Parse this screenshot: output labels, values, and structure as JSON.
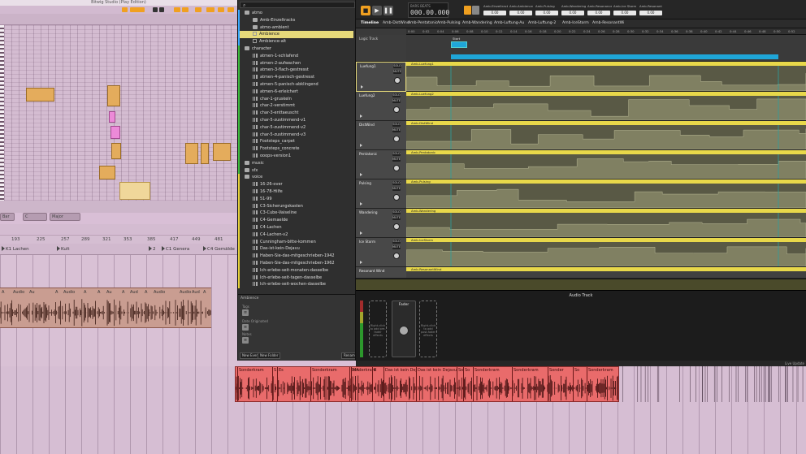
{
  "piano_roll": {
    "title": "Bitwig Studio (Play Edition)",
    "ruler_marks": [
      "1",
      "2",
      "3",
      "4",
      "5",
      "6",
      "7",
      "8"
    ],
    "scale_select": "Bar",
    "key_select": "C",
    "mode_select": "Major"
  },
  "arrangement": {
    "ruler": [
      "193",
      "225",
      "257",
      "289",
      "321",
      "353",
      "385",
      "417",
      "449",
      "481"
    ],
    "locators": [
      "K1 Lachen",
      "Kult",
      "2",
      "C1 Genera",
      "C4 Gemälde"
    ],
    "clip_labels": [
      "A",
      "Audio",
      "Au",
      "A",
      "Audio",
      "A",
      "A",
      "Au",
      "A",
      "Aud",
      "A",
      "Audio",
      "A",
      "Aud",
      "Aud",
      "Au",
      "Aud",
      "Au",
      "Audio",
      "A"
    ]
  },
  "browser": {
    "search_placeholder": "",
    "items": [
      {
        "label": "atmo",
        "type": "folder",
        "indent": 0,
        "color": "#3aa9ff"
      },
      {
        "label": "Amb-Einzeltracks",
        "type": "folder",
        "indent": 1,
        "color": "#3aa9ff"
      },
      {
        "label": "atmo-ambient",
        "type": "folder",
        "indent": 1,
        "color": "#3aa9ff"
      },
      {
        "label": "Ambience",
        "type": "file",
        "indent": 1,
        "color": "#3aa9ff",
        "selected": true
      },
      {
        "label": "Ambience-alt",
        "type": "file",
        "indent": 1,
        "color": "#3aa9ff"
      },
      {
        "label": "character",
        "type": "folder",
        "indent": 0,
        "color": "#3dbb3d"
      },
      {
        "label": "atmen-1-schlafend",
        "type": "audio",
        "indent": 1,
        "color": "#3dbb3d"
      },
      {
        "label": "atmen-2-aufwachen",
        "type": "audio",
        "indent": 1,
        "color": "#3dbb3d"
      },
      {
        "label": "atmen-3-flach-gestresst",
        "type": "audio",
        "indent": 1,
        "color": "#3dbb3d"
      },
      {
        "label": "atmen-4-panisch-gestresst",
        "type": "audio",
        "indent": 1,
        "color": "#3dbb3d"
      },
      {
        "label": "atmen-5-panisch-abklingend",
        "type": "audio",
        "indent": 1,
        "color": "#3dbb3d"
      },
      {
        "label": "atmen-6-erleichert",
        "type": "audio",
        "indent": 1,
        "color": "#3dbb3d"
      },
      {
        "label": "char-1-gruskeln",
        "type": "audio",
        "indent": 1,
        "color": "#3dbb3d"
      },
      {
        "label": "char-2-verstimmt",
        "type": "audio",
        "indent": 1,
        "color": "#3dbb3d"
      },
      {
        "label": "char-3-enttaeuscht",
        "type": "audio",
        "indent": 1,
        "color": "#3dbb3d"
      },
      {
        "label": "char-5-zustimmend-v1",
        "type": "audio",
        "indent": 1,
        "color": "#3dbb3d"
      },
      {
        "label": "char-5-zustimmend-v2",
        "type": "audio",
        "indent": 1,
        "color": "#3dbb3d"
      },
      {
        "label": "char-5-zustimmend-v3",
        "type": "audio",
        "indent": 1,
        "color": "#3dbb3d"
      },
      {
        "label": "Footsteps_carpet",
        "type": "audio",
        "indent": 1,
        "color": "#3dbb3d"
      },
      {
        "label": "Footsteps_concrete",
        "type": "audio",
        "indent": 1,
        "color": "#3dbb3d"
      },
      {
        "label": "ooops-version1",
        "type": "audio",
        "indent": 1,
        "color": "#3dbb3d"
      },
      {
        "label": "music",
        "type": "folder",
        "indent": 0,
        "color": "#3dbb3d"
      },
      {
        "label": "sfx",
        "type": "folder",
        "indent": 0,
        "color": "#3dbb3d"
      },
      {
        "label": "voice",
        "type": "folder",
        "indent": 0,
        "color": "#e6d13a"
      },
      {
        "label": "16-26-over",
        "type": "audio",
        "indent": 1,
        "color": "#e6d13a"
      },
      {
        "label": "16-78-Hilfe",
        "type": "audio",
        "indent": 1,
        "color": "#e6d13a"
      },
      {
        "label": "51-99",
        "type": "audio",
        "indent": 1,
        "color": "#e6d13a"
      },
      {
        "label": "C3-Sicherungskasten",
        "type": "audio",
        "indent": 1,
        "color": "#e6d13a"
      },
      {
        "label": "C3-Cube-Vaiseline",
        "type": "audio",
        "indent": 1,
        "color": "#e6d13a"
      },
      {
        "label": "C4-Gemaelde",
        "type": "audio",
        "indent": 1,
        "color": "#e6d13a"
      },
      {
        "label": "C4-Lachen",
        "type": "audio",
        "indent": 1,
        "color": "#e6d13a"
      },
      {
        "label": "C4-Lachen-v2",
        "type": "audio",
        "indent": 1,
        "color": "#e6d13a"
      },
      {
        "label": "Cunningham-bitte-kommen",
        "type": "audio",
        "indent": 1,
        "color": "#e6d13a"
      },
      {
        "label": "Das-ist-kein-Dejavu",
        "type": "audio",
        "indent": 1,
        "color": "#e6d13a"
      },
      {
        "label": "Haben-Sie-das-mitgeschrieben-1942",
        "type": "audio",
        "indent": 1,
        "color": "#e6d13a"
      },
      {
        "label": "Haben-Sie-das-mitgeschrieben-1962",
        "type": "audio",
        "indent": 1,
        "color": "#e6d13a"
      },
      {
        "label": "Ich-erlebe-seit-monaten-dasselbe",
        "type": "audio",
        "indent": 1,
        "color": "#e6d13a"
      },
      {
        "label": "Ich-erlebe-seit-tagen-dasselbe",
        "type": "audio",
        "indent": 1,
        "color": "#e6d13a"
      },
      {
        "label": "Ich-erlebe-seit-wochen-dasselbe",
        "type": "audio",
        "indent": 1,
        "color": "#e6d13a"
      }
    ],
    "info_title": "Ambience",
    "info_labels": [
      "Tags",
      "Date Originated",
      "Notes"
    ],
    "footer": {
      "new_button": "New Event",
      "folder_button": "New Folder",
      "search_button": "Rename"
    }
  },
  "project": {
    "time_label": "BARS BEATS",
    "time_value": "000.00.000",
    "macro_params": [
      {
        "label": "Amb-Einzeltracks",
        "value": "0.00"
      },
      {
        "label": "Amb-Ambience",
        "value": "0.00"
      },
      {
        "label": "Amb-Pulsing",
        "value": "0.00"
      },
      {
        "label": "Amb-Wandering",
        "value": "0.00"
      },
      {
        "label": "Amb-Resonance",
        "value": "0.00"
      },
      {
        "label": "Amb-Ice Storm",
        "value": "0.00"
      },
      {
        "label": "Amb-Resonant",
        "value": "0.00"
      }
    ],
    "tabs": [
      "Timeline",
      "Amb-DistWind",
      "Amb-Pentatonic",
      "Amb-Pulsing",
      "Amb-Wandering",
      "Amb-Luftung-Au",
      "Amb-Luftung-2",
      "Amb-IceStorm",
      "Amb-ResonantWi"
    ],
    "ruler_ticks": [
      "0:00",
      "0:02",
      "0:04",
      "0:06",
      "0:08",
      "0:10",
      "0:12",
      "0:14",
      "0:16",
      "0:18",
      "0:20",
      "0:22",
      "0:24",
      "0:26",
      "0:28",
      "0:30",
      "0:32",
      "0:34",
      "0:36",
      "0:38",
      "0:40",
      "0:42",
      "0:44",
      "0:46",
      "0:48",
      "0:50",
      "0:52"
    ],
    "logic_track": "Logic Track",
    "logic_clip": "Start",
    "tracks": [
      {
        "name": "Luefung1",
        "clip": "Amb-Luefung1"
      },
      {
        "name": "Luefung2",
        "clip": "Amb-Luefung2"
      },
      {
        "name": "DistWind",
        "clip": "Amb-DistWind"
      },
      {
        "name": "Pentatonic",
        "clip": "Amb-Pentatonic"
      },
      {
        "name": "Pulsing",
        "clip": "Amb-Pulsing"
      },
      {
        "name": "Wandering",
        "clip": "Amb-Wandering"
      },
      {
        "name": "Ice Storm",
        "clip": "Amb-IceStorm"
      },
      {
        "name": "Resonant Wind",
        "clip": "Amb-ResonantWind"
      }
    ],
    "solo": "SOLO",
    "mute": "MUTE",
    "device_title": "Audio Track",
    "fader_label": "Fader",
    "slot_text": "Right-click to add pre-fader effects",
    "slot_text_post": "Right-click to add post-fader effects",
    "status": "Live Update"
  },
  "bottom": {
    "clips": [
      "Sonderkram",
      "S",
      "Es",
      "Sonderkram",
      "Sonderkram",
      "MA",
      "B",
      "Das ist kein Dej",
      "Das ist kein Dejavu",
      "So",
      "So",
      "Sonderkram",
      "Sonderkram",
      "Sonder",
      "So",
      "Sonderkram"
    ]
  },
  "colors": {
    "accent": "#f0a020",
    "track_clip": "#e8d84a",
    "logic": "#1fa6d8",
    "red_clip": "#e96b6b"
  }
}
